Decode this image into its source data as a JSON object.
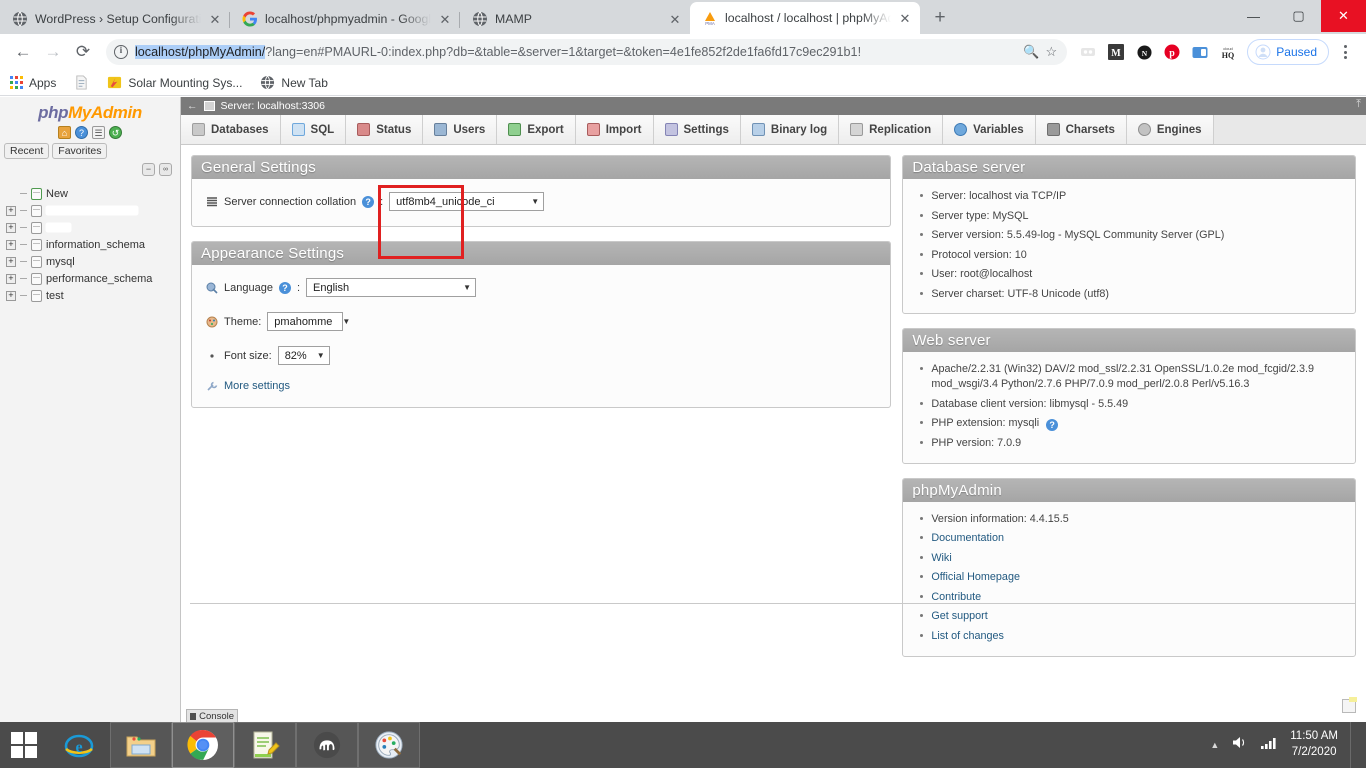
{
  "browser": {
    "tabs": [
      {
        "title": "WordPress › Setup Configuration",
        "favicon": "globe-icon",
        "active": false
      },
      {
        "title": "localhost/phpmyadmin - Google",
        "favicon": "google-icon",
        "active": false
      },
      {
        "title": "MAMP",
        "favicon": "globe-icon",
        "active": false
      },
      {
        "title": "localhost / localhost | phpMyAdm",
        "favicon": "pma-icon",
        "active": true
      }
    ],
    "new_tab_label": "+",
    "window_controls": {
      "minimize": "—",
      "maximize": "▢",
      "close": "✕"
    },
    "nav": {
      "back": "←",
      "forward": "→",
      "reload": "⟳"
    },
    "omnibox": {
      "url_selected": "localhost/phpMyAdmin/",
      "url_rest": "?lang=en#PMAURL-0:index.php?db=&table=&server=1&target=&token=4e1fe852f2de1fa6fd17c9ec291b1!",
      "site_info_icon": "info-icon",
      "search_icon": "search-icon",
      "star_icon": "star-icon"
    },
    "extensions": [
      "lastpass-icon",
      "medium-icon",
      "notion-icon",
      "pinterest-icon",
      "tab-snooze-icon",
      "cloudhq-icon"
    ],
    "sync_status": "Paused",
    "menu_icon": "kebab-menu-icon",
    "bookmarks": [
      {
        "label": "Apps",
        "icon": "apps-grid-icon"
      },
      {
        "label": "Solar Mounting Sys...",
        "icon": "page-icon"
      },
      {
        "label": "New Tab",
        "icon": "globe-icon"
      }
    ]
  },
  "pma": {
    "logo": {
      "part1": "php",
      "part2": "MyAdmin"
    },
    "logo_icons": [
      "home-icon",
      "help-icon",
      "docs-icon",
      "reload-icon"
    ],
    "nav_pills": [
      "Recent",
      "Favorites"
    ],
    "nav_mini_buttons": [
      "collapse-all-icon",
      "link-icon"
    ],
    "databases": [
      {
        "label": "New",
        "redacted": false,
        "expandable": false
      },
      {
        "label": "",
        "redacted": true,
        "expandable": true,
        "width": 92
      },
      {
        "label": "",
        "redacted": true,
        "expandable": true,
        "width": 25
      },
      {
        "label": "information_schema",
        "redacted": false,
        "expandable": true
      },
      {
        "label": "mysql",
        "redacted": false,
        "expandable": true
      },
      {
        "label": "performance_schema",
        "redacted": false,
        "expandable": true
      },
      {
        "label": "test",
        "redacted": false,
        "expandable": true
      }
    ],
    "server_bar": {
      "label": "Server: localhost:3306",
      "icon": "server-icon",
      "back_arrow": "←",
      "collapse": "⤒"
    },
    "tabs": [
      {
        "label": "Databases",
        "icon": "database-icon",
        "color": "#c9c9c9"
      },
      {
        "label": "SQL",
        "icon": "sql-icon",
        "color": "#8fb8de"
      },
      {
        "label": "Status",
        "icon": "status-icon",
        "color": "#d98a8a"
      },
      {
        "label": "Users",
        "icon": "users-icon",
        "color": "#9bb7d4"
      },
      {
        "label": "Export",
        "icon": "export-icon",
        "color": "#7fbf7f"
      },
      {
        "label": "Import",
        "icon": "import-icon",
        "color": "#d98a8a"
      },
      {
        "label": "Settings",
        "icon": "settings-icon",
        "color": "#b0b0d8"
      },
      {
        "label": "Binary log",
        "icon": "binarylog-icon",
        "color": "#a8c4e0"
      },
      {
        "label": "Replication",
        "icon": "replication-icon",
        "color": "#9a9a9a"
      },
      {
        "label": "Variables",
        "icon": "variables-icon",
        "color": "#6fa8dc"
      },
      {
        "label": "Charsets",
        "icon": "charsets-icon",
        "color": "#888888"
      },
      {
        "label": "Engines",
        "icon": "engines-icon",
        "color": "#9a9a9a"
      }
    ],
    "general_settings": {
      "title": "General Settings",
      "collation_label": "Server connection collation",
      "collation_value": "utf8mb4_unicode_ci"
    },
    "appearance_settings": {
      "title": "Appearance Settings",
      "language_label": "Language",
      "language_value": "English",
      "theme_label": "Theme:",
      "theme_value": "pmahomme",
      "fontsize_label": "Font size:",
      "fontsize_value": "82%",
      "more_settings": "More settings"
    },
    "database_server": {
      "title": "Database server",
      "items": [
        "Server: localhost via TCP/IP",
        "Server type: MySQL",
        "Server version: 5.5.49-log - MySQL Community Server (GPL)",
        "Protocol version: 10",
        "User: root@localhost",
        "Server charset: UTF-8 Unicode (utf8)"
      ]
    },
    "web_server": {
      "title": "Web server",
      "items": [
        "Apache/2.2.31 (Win32) DAV/2 mod_ssl/2.2.31 OpenSSL/1.0.2e mod_fcgid/2.3.9 mod_wsgi/3.4 Python/2.7.6 PHP/7.0.9 mod_perl/2.0.8 Perl/v5.16.3",
        "Database client version: libmysql - 5.5.49",
        "PHP extension: mysqli",
        "PHP version: 7.0.9"
      ]
    },
    "phpmyadmin_info": {
      "title": "phpMyAdmin",
      "items": [
        "Version information: 4.4.15.5",
        "Documentation",
        "Wiki",
        "Official Homepage",
        "Contribute",
        "Get support",
        "List of changes"
      ]
    },
    "console_label": "Console",
    "highlight_color": "#e02020"
  },
  "taskbar": {
    "start_icon": "windows-start-icon",
    "items": [
      {
        "icon": "internet-explorer-icon",
        "boxed": false
      },
      {
        "icon": "file-explorer-icon",
        "boxed": true
      },
      {
        "icon": "chrome-icon",
        "boxed": true,
        "active": true
      },
      {
        "icon": "notepad-plus-plus-icon",
        "boxed": true
      },
      {
        "icon": "mamp-icon",
        "boxed": true
      },
      {
        "icon": "paint-icon",
        "boxed": true
      }
    ],
    "tray": {
      "expand_icon": "show-hidden-icons",
      "volume_icon": "volume-icon",
      "network_icon": "network-icon"
    },
    "time": "11:50 AM",
    "date": "7/2/2020"
  }
}
